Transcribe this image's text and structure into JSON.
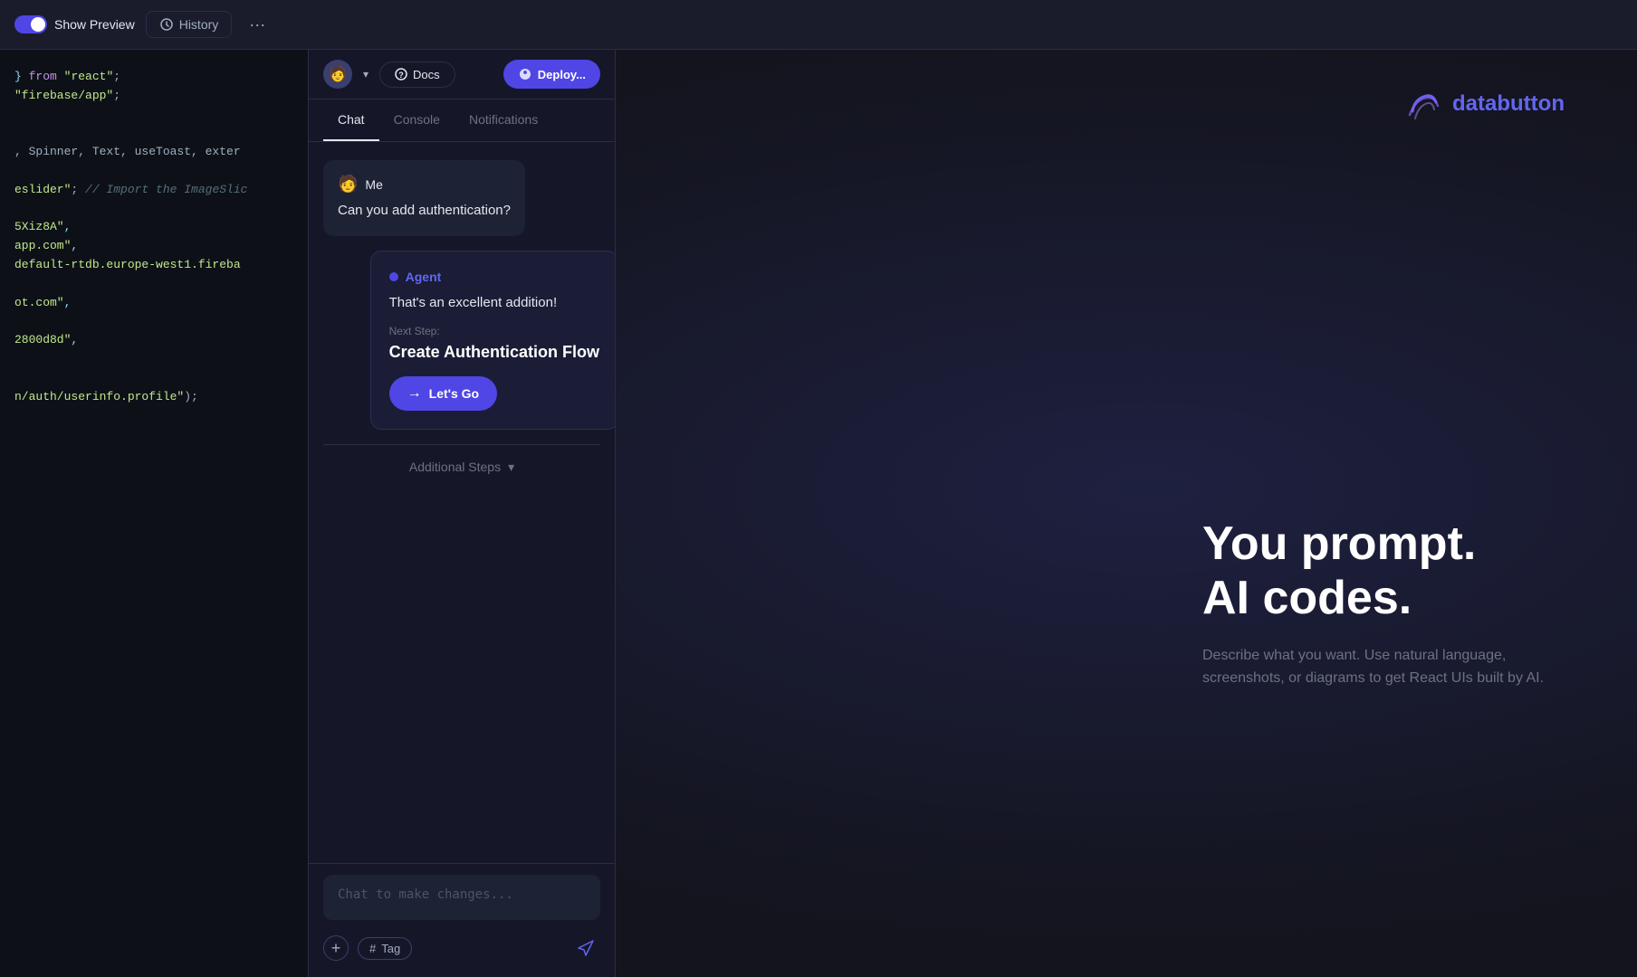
{
  "toolbar": {
    "toggle_label": "Show Preview",
    "history_label": "History",
    "more_icon": "•••"
  },
  "topbar": {
    "docs_label": "Docs",
    "deploy_label": "Deploy...",
    "avatar_emoji": "🧑"
  },
  "tabs": {
    "chat": "Chat",
    "console": "Console",
    "notifications": "Notifications",
    "active": "Chat"
  },
  "user_message": {
    "author": "Me",
    "avatar": "🧑",
    "text": "Can you add authentication?"
  },
  "agent_message": {
    "label": "Agent",
    "text": "That's an excellent addition!",
    "next_step_label": "Next Step:",
    "next_step_title": "Create Authentication Flow",
    "lets_go_label": "Let's Go"
  },
  "additional_steps": {
    "label": "Additional Steps",
    "icon": "▾"
  },
  "chat_input": {
    "placeholder": "Chat to make changes..."
  },
  "input_actions": {
    "add_label": "+",
    "tag_label": "Tag",
    "tag_icon": "#"
  },
  "code_lines": [
    {
      "parts": [
        {
          "type": "punct",
          "text": "} "
        },
        {
          "type": "kw",
          "text": "from"
        },
        {
          "type": "str",
          "text": " \"react\""
        }
      ],
      "suffix": ";"
    },
    {
      "parts": [
        {
          "type": "str",
          "text": "\"firebase/app\""
        }
      ],
      "suffix": ";"
    },
    {
      "parts": [],
      "suffix": ""
    },
    {
      "parts": [],
      "suffix": ""
    },
    {
      "parts": [
        {
          "type": "plain",
          "text": ", Spinner, Text, useToast, exter"
        }
      ],
      "suffix": ""
    },
    {
      "parts": [],
      "suffix": ""
    },
    {
      "parts": [
        {
          "type": "str",
          "text": "eslider\""
        },
        {
          "type": "comment",
          "text": "; // Import the ImageSlic"
        }
      ],
      "suffix": ""
    },
    {
      "parts": [],
      "suffix": ""
    },
    {
      "parts": [
        {
          "type": "str",
          "text": "5Xiz8A\""
        },
        {
          "type": "punct",
          "text": ","
        }
      ],
      "suffix": ""
    },
    {
      "parts": [
        {
          "type": "str",
          "text": "app.com\""
        },
        {
          "type": "punct",
          "text": ","
        }
      ],
      "suffix": ""
    },
    {
      "parts": [
        {
          "type": "str",
          "text": "default-rtdb.europe-west1.fireba"
        }
      ],
      "suffix": ""
    },
    {
      "parts": [],
      "suffix": ""
    },
    {
      "parts": [
        {
          "type": "str",
          "text": "ot.com\""
        },
        {
          "type": "punct",
          "text": ","
        }
      ],
      "suffix": ""
    },
    {
      "parts": [],
      "suffix": ""
    },
    {
      "parts": [
        {
          "type": "str",
          "text": "2800d8d\""
        },
        {
          "type": "punct",
          "text": ","
        }
      ],
      "suffix": ""
    },
    {
      "parts": [],
      "suffix": ""
    },
    {
      "parts": [],
      "suffix": ""
    },
    {
      "parts": [
        {
          "type": "str",
          "text": "n/auth/userinfo.profile\""
        }
      ],
      "suffix": ");"
    }
  ],
  "marketing": {
    "logo_text": "databutton",
    "headline_line1": "You prompt.",
    "headline_line2": "AI codes.",
    "subtext": "Describe what you want. Use natural language, screenshots, or diagrams to get React UIs built by AI."
  }
}
